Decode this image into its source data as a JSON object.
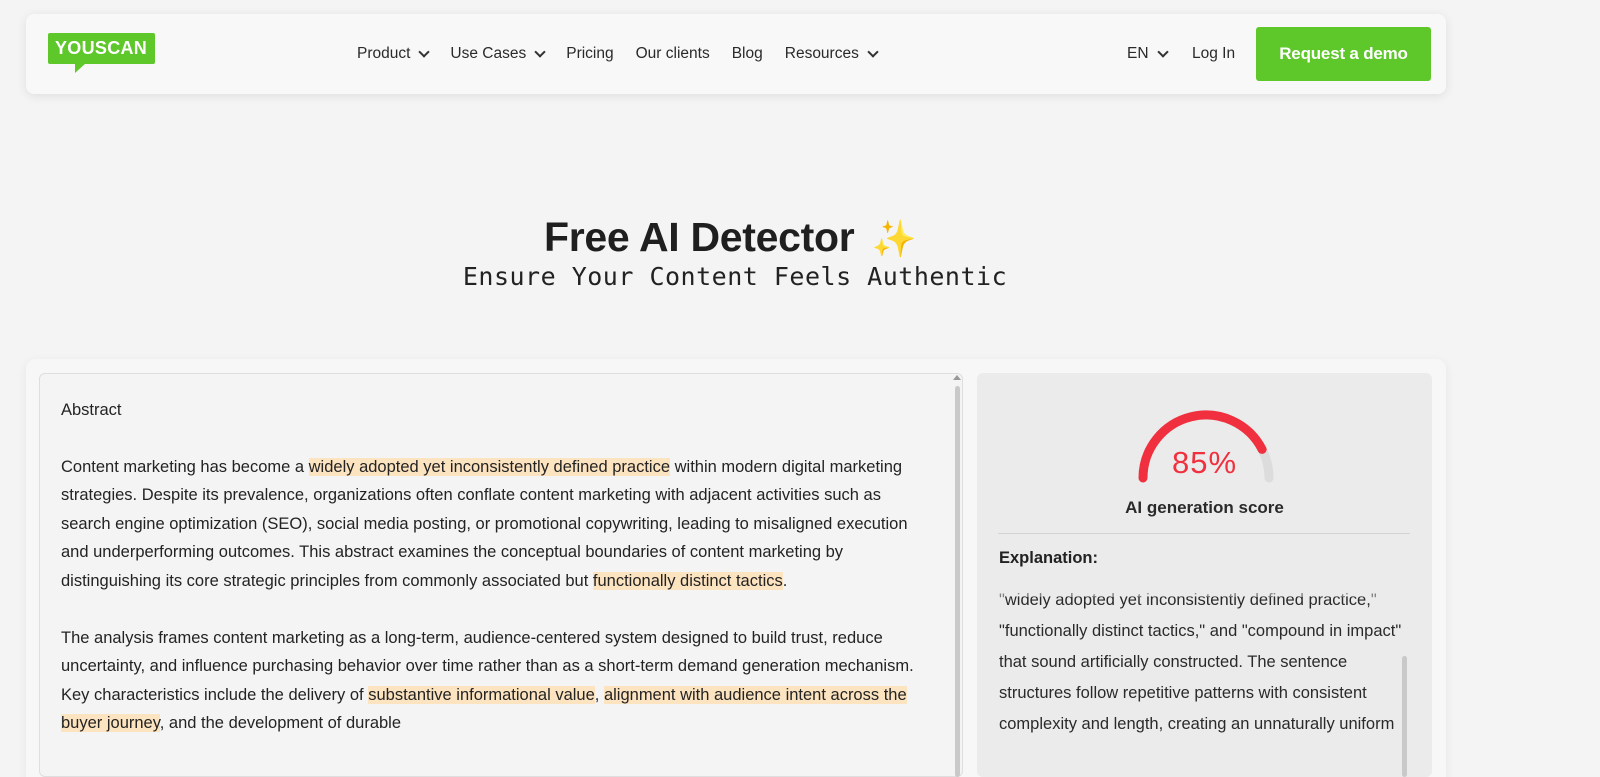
{
  "nav": {
    "logo": "YOUSCAN",
    "items": [
      {
        "label": "Product",
        "dropdown": true
      },
      {
        "label": "Use Cases",
        "dropdown": true
      },
      {
        "label": "Pricing",
        "dropdown": false
      },
      {
        "label": "Our clients",
        "dropdown": false
      },
      {
        "label": "Blog",
        "dropdown": false
      },
      {
        "label": "Resources",
        "dropdown": true
      }
    ],
    "lang": "EN",
    "login": "Log In",
    "cta": "Request a demo"
  },
  "hero": {
    "title": "Free AI Detector",
    "icon": "sparkles-icon",
    "subtitle": "Ensure Your Content Feels Authentic"
  },
  "analysis": {
    "heading": "Abstract",
    "p1": {
      "t1": "Content marketing has become a ",
      "h1": "widely adopted yet inconsistently defined practice",
      "t2": " within modern digital marketing strategies. Despite its prevalence, organizations often conflate content marketing with adjacent activities such as search engine optimization (SEO), social media posting, or promotional copywriting, leading to misaligned execution and underperforming outcomes. This abstract examines the conceptual boundaries of content marketing by distinguishing its core strategic principles from commonly associated but ",
      "h2": "functionally distinct tactics",
      "t3": "."
    },
    "p2": {
      "t1": "The analysis frames content marketing as a long-term, audience-centered system designed to build trust, reduce uncertainty, and influence purchasing behavior over time rather than as a short-term demand generation mechanism. Key characteristics include the delivery of ",
      "h1": "substantive informational value",
      "t2": ", ",
      "h2": "alignment with audience intent across the buyer journey",
      "t3": ", and the development of durable"
    }
  },
  "result": {
    "score": "85%",
    "score_value": 0.85,
    "score_label": "AI generation score",
    "explanation_title": "Explanation:",
    "explanation_text": "\"widely adopted yet inconsistently defined practice,\" \"functionally distinct tactics,\" and \"compound in impact\" that sound artificially constructed. The sentence structures follow repetitive patterns with consistent complexity and length, creating an unnaturally uniform",
    "colors": {
      "score": "#f0303e",
      "highlight": "#fde4c0",
      "brand": "#5ec72a"
    }
  }
}
